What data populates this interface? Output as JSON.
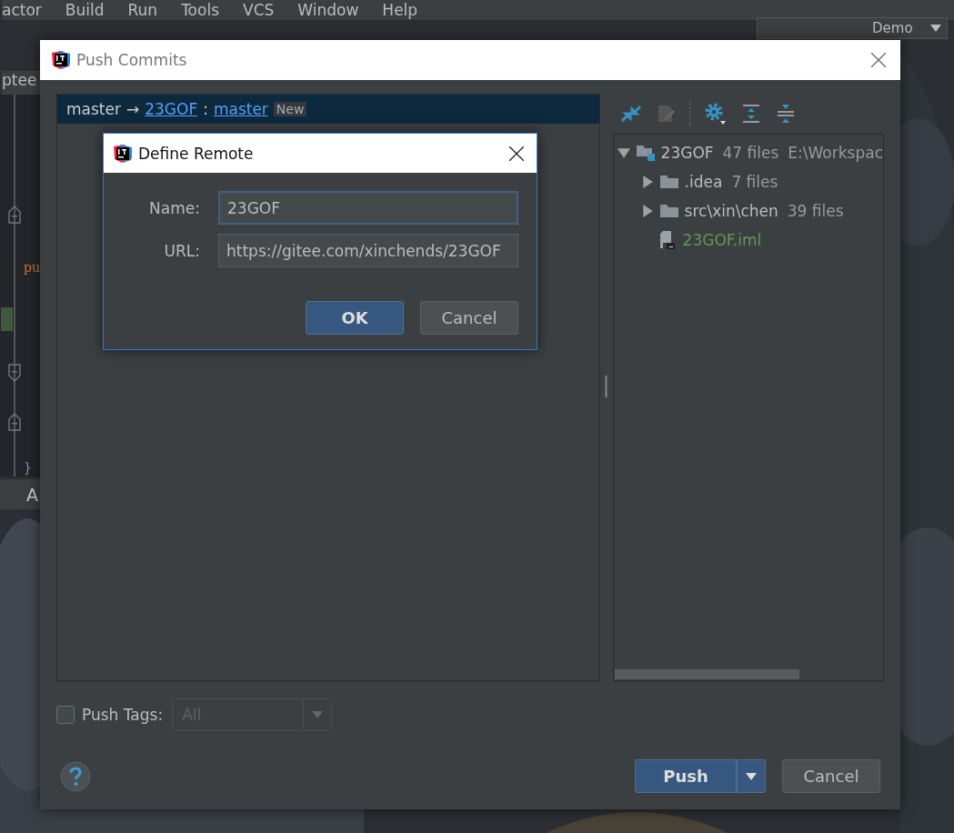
{
  "ide": {
    "menu": [
      {
        "label": "actor"
      },
      {
        "label": "Build"
      },
      {
        "label": "Run"
      },
      {
        "label": "Tools"
      },
      {
        "label": "VCS"
      },
      {
        "label": "Window"
      },
      {
        "label": "Help"
      }
    ],
    "run_config": "Demo",
    "editor_tab": "ptee",
    "code_lines": [
      {
        "text": "pu",
        "kind": "keyword"
      },
      {
        "text": "}",
        "kind": "brace"
      }
    ],
    "bottom_tab": "A"
  },
  "push_dialog": {
    "title": "Push Commits",
    "branch": {
      "local": "master",
      "arrow": "→",
      "remote": "23GOF",
      "separator": ":",
      "remote_branch": "master",
      "badge": "New",
      "selected": true
    },
    "tree": [
      {
        "name": "23GOF",
        "count": "47 files",
        "path": "E:\\Workspac",
        "kind": "module",
        "expanded": true,
        "children": [
          {
            "name": ".idea",
            "count": "7 files",
            "kind": "folder",
            "expanded": false
          },
          {
            "name": "src\\xin\\chen",
            "count": "39 files",
            "kind": "folder",
            "expanded": false
          },
          {
            "name": "23GOF.iml",
            "kind": "file"
          }
        ]
      }
    ],
    "push_tags": {
      "label": "Push Tags:",
      "checked": false,
      "value": "All",
      "disabled": true
    },
    "buttons": [
      {
        "label": "Push",
        "kind": "primary"
      },
      {
        "label": "Cancel",
        "kind": "normal"
      }
    ]
  },
  "remote_dialog": {
    "title": "Define Remote",
    "fields": [
      {
        "label": "Name:",
        "value": "23GOF",
        "focused": true
      },
      {
        "label": "URL:",
        "value": "https://gitee.com/xinchends/23GOF",
        "focused": false
      }
    ],
    "buttons": [
      {
        "label": "OK",
        "kind": "primary"
      },
      {
        "label": "Cancel",
        "kind": "normal"
      }
    ]
  }
}
